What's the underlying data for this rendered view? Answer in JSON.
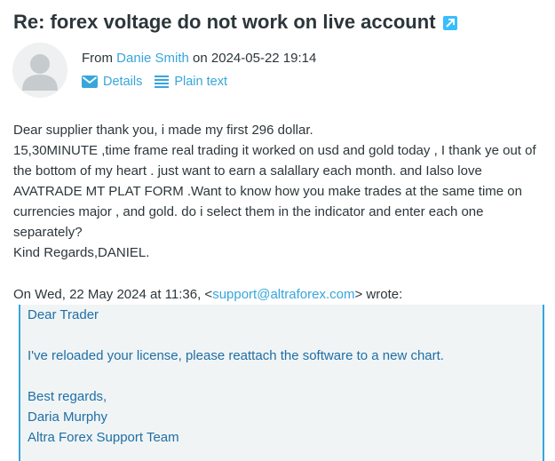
{
  "message": {
    "subject": "Re: forex voltage do not work on live account",
    "from_prefix": "From ",
    "sender_name": "Danie Smith",
    "date_prefix": " on ",
    "date": "2024-05-22 19:14",
    "actions": {
      "details": "Details",
      "plain_text": "Plain text"
    },
    "body_lines": [
      "Dear supplier thank you, i made my first 296 dollar.",
      "15,30MINUTE ,time frame real trading it worked on usd and gold today , I thank ye out of",
      "the bottom of my heart . just want to earn a salallary each month. and Ialso love",
      "AVATRADE MT PLAT FORM .Want to know how you make trades at the same time on",
      "currencies major , and gold. do i select them in the indicator and enter each one",
      "separately?",
      "Kind Regards,DANIEL."
    ],
    "quote_intro_prefix": "On Wed, 22 May 2024 at 11:36, <",
    "quote_email": "support@altraforex.com",
    "quote_intro_suffix": "> wrote:",
    "quote_lines": {
      "greeting": "Dear Trader",
      "line1": "I've reloaded your license, please reattach the software to a new chart.",
      "regards": "Best regards,",
      "name": "Daria Murphy",
      "team": "Altra Forex Support Team"
    }
  },
  "colors": {
    "accent": "#37a6db",
    "text": "#2c363a",
    "quote_text": "#1f6fa6",
    "quote_bg": "#f0f4f5"
  },
  "icons": [
    "external-link-icon",
    "user-avatar-icon",
    "envelope-icon",
    "list-icon"
  ]
}
